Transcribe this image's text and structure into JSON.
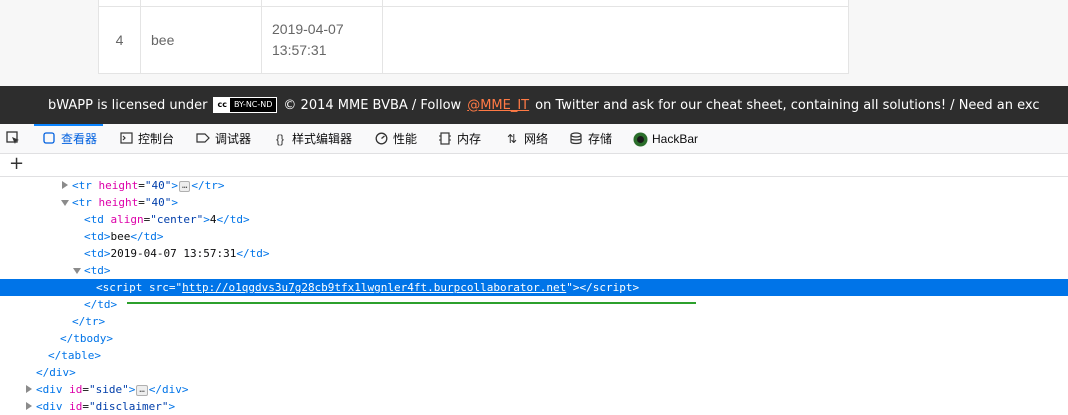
{
  "page_table": {
    "row": {
      "num": "4",
      "name": "bee",
      "date_line1": "2019-04-07",
      "date_line2": "13:57:31"
    }
  },
  "banner": {
    "text1": "bWAPP is licensed under",
    "cc_badge": "cc",
    "cc_license": "BY-NC-ND",
    "text2": "© 2014 MME BVBA / Follow",
    "twitter": "@MME_IT",
    "text3": "on Twitter and ask for our cheat sheet, containing all solutions! / Need an exc"
  },
  "devtools": {
    "tabs": [
      {
        "label": "查看器",
        "icon": "inspector-icon",
        "active": true
      },
      {
        "label": "控制台",
        "icon": "console-icon"
      },
      {
        "label": "调试器",
        "icon": "debugger-icon"
      },
      {
        "label": "样式编辑器",
        "icon": "style-editor-icon"
      },
      {
        "label": "性能",
        "icon": "performance-icon"
      },
      {
        "label": "内存",
        "icon": "memory-icon"
      },
      {
        "label": "网络",
        "icon": "network-icon"
      },
      {
        "label": "存储",
        "icon": "storage-icon"
      },
      {
        "label": "HackBar",
        "icon": "hackbar-icon"
      }
    ],
    "add_node": "+",
    "markup": {
      "tr1_tag": "tr",
      "tr1_attr": "height",
      "tr1_val": "\"40\"",
      "tr2_tag": "tr",
      "tr2_attr": "height",
      "tr2_val": "\"40\"",
      "td1_attr": "align",
      "td1_val": "\"center\"",
      "td1_text": "4",
      "td2_text": "bee",
      "td3_text": "2019-04-07 13:57:31",
      "script_attr": "src",
      "script_url": "http://o1qgdvs3u7g28cb9tfx1lwgnler4ft.burpcollaborator.net",
      "div_side_attr": "id",
      "div_side_val": "\"side\"",
      "div_disc_attr": "id",
      "div_disc_val": "\"disclaimer\""
    }
  },
  "colors": {
    "selection": "#0074e8",
    "tag": "#0074e8",
    "attr_name": "#dd00a9",
    "attr_value": "#003eaa",
    "banner_bg": "#2d2d2d",
    "twitter_link": "#ff7a45",
    "annotation_line": "#2ca02c"
  }
}
